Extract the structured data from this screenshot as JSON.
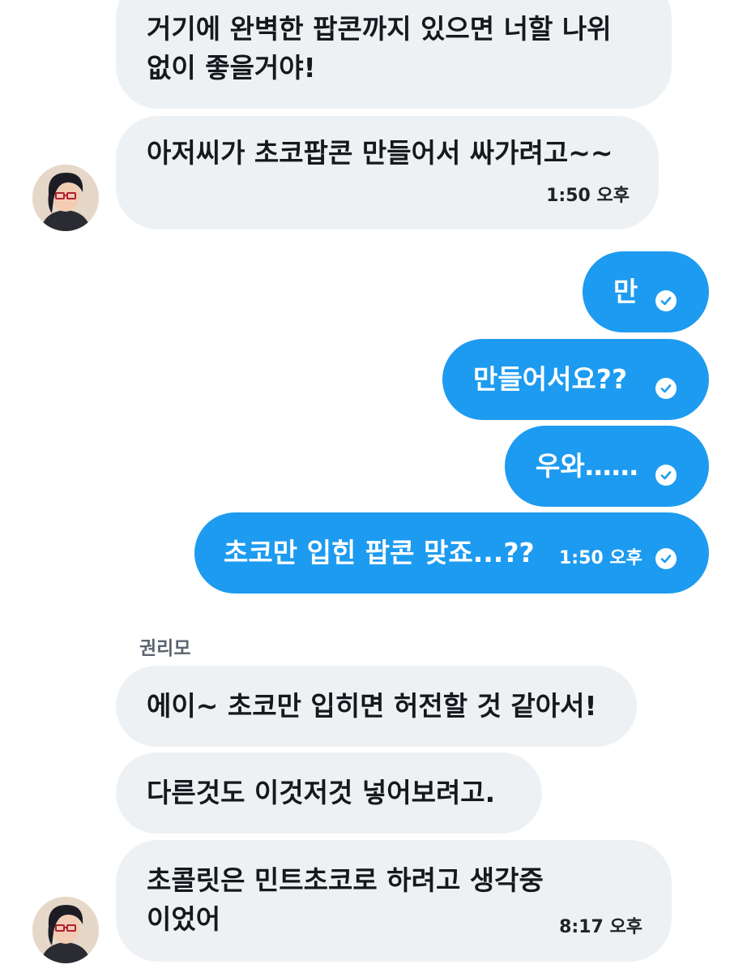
{
  "incoming_top": [
    {
      "text": "거기에 완벽한 팝콘까지 있으면 너할 나위 없이 좋을거야!",
      "time": ""
    },
    {
      "text": "아저씨가 초코팝콘 만들어서 싸가려고~~",
      "time": "1:50 오후"
    }
  ],
  "outgoing": [
    {
      "text": "만",
      "time": ""
    },
    {
      "text": "만들어서요??",
      "time": ""
    },
    {
      "text": "우와……",
      "time": ""
    },
    {
      "text": "초코만 입힌 팝콘 맞죠...??",
      "time": "1:50 오후"
    }
  ],
  "sender_name": "권리모",
  "incoming_bottom": [
    {
      "text": "에이~ 초코만 입히면 허전할 것 같아서!",
      "time": ""
    },
    {
      "text": "다른것도 이것저것 넣어보려고.",
      "time": ""
    },
    {
      "text": "초콜릿은 민트초코로 하려고 생각중이었어",
      "time": "8:17 오후"
    }
  ],
  "icons": {
    "read_receipt": "check-circle-icon",
    "avatar": "avatar-icon"
  },
  "colors": {
    "outgoing_bubble": "#1d9bf0",
    "incoming_bubble": "#eef1f4",
    "background": "#ffffff"
  }
}
